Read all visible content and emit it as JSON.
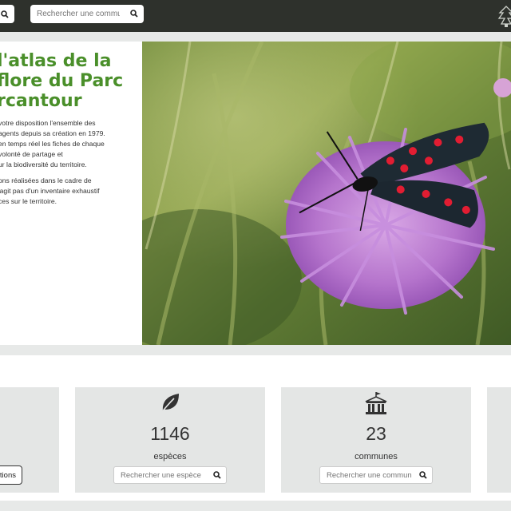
{
  "topbar": {
    "search_placeholder": "Rechercher une commune",
    "icons": [
      "search-icon",
      "park-logo-icon"
    ]
  },
  "hero": {
    "title_lines": [
      "l'atlas de la",
      "flore du Parc",
      "rcantour"
    ],
    "paragraph1_lines": [
      "votre disposition l'ensemble des",
      "agents depuis sa création en 1979.",
      "en temps réel les fiches de chaque",
      "volonté de partage et",
      "ur la biodiversité du territoire."
    ],
    "paragraph2_lines": [
      "ons réalisées dans le cadre de",
      "'agit pas d'un inventaire exhaustif",
      "ces sur le territoire."
    ]
  },
  "stats": {
    "observations_button": "tions",
    "species": {
      "count": "1146",
      "label": "espèces",
      "search_placeholder": "Rechercher une espèce",
      "icon": "leaf-icon"
    },
    "communes": {
      "count": "23",
      "label": "communes",
      "search_placeholder": "Rechercher une commune",
      "icon": "town-hall-icon"
    }
  },
  "colors": {
    "topbar": "#2e312c",
    "title_green": "#4a8f2a",
    "card_bg": "#e4e6e5",
    "page_bg": "#e7e9e8"
  }
}
